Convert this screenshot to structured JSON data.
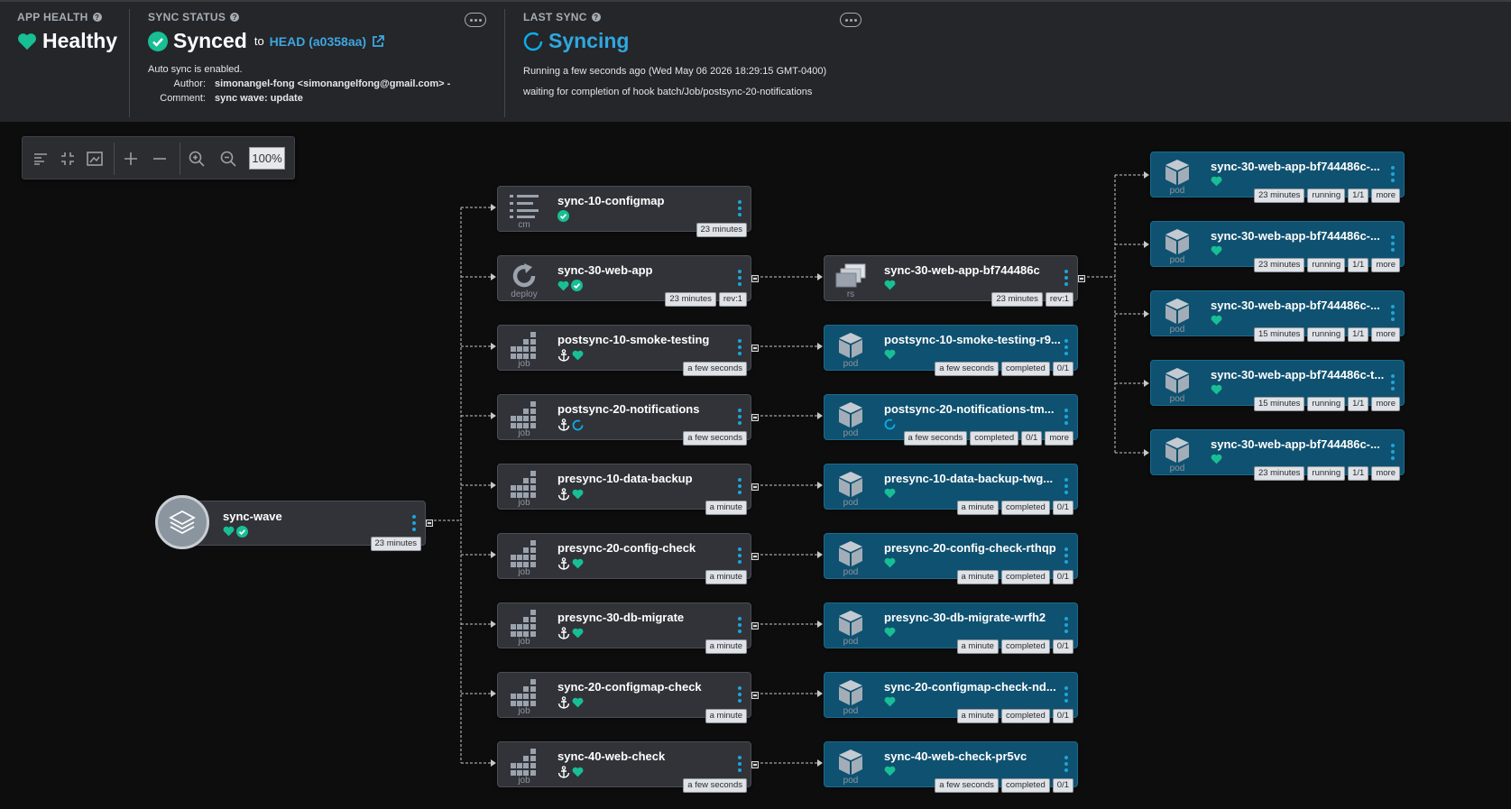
{
  "header": {
    "app_health": {
      "label": "APP HEALTH",
      "value": "Healthy"
    },
    "sync_status": {
      "label": "SYNC STATUS",
      "value": "Synced",
      "to": "to",
      "revision": "HEAD (a0358aa)",
      "auto_sync": "Auto sync is enabled.",
      "author_label": "Author:",
      "author": "simonangel-fong <simonangelfong@gmail.com> -",
      "comment_label": "Comment:",
      "comment": "sync wave: update"
    },
    "last_sync": {
      "label": "LAST SYNC",
      "value": "Syncing",
      "running": "Running a few seconds ago (Wed May 06 2026 18:29:15 GMT-0400)",
      "message": "waiting for completion of hook batch/Job/postsync-20-notifications"
    }
  },
  "toolbar": {
    "zoom": "100%"
  },
  "colors": {
    "healthy": "#18be94",
    "syncing": "#0dadea",
    "link": "#3ea6e0",
    "pod_bg": "#0f5170"
  },
  "app": {
    "name": "sync-wave",
    "age": "23 minutes"
  },
  "resources": [
    {
      "name": "sync-10-configmap",
      "kind": "cm",
      "icon": "list-icon",
      "status": [
        "check"
      ],
      "tags": [
        "23 minutes"
      ]
    },
    {
      "name": "sync-30-web-app",
      "kind": "deploy",
      "icon": "refresh-icon",
      "status": [
        "heart",
        "check"
      ],
      "tags": [
        "23 minutes",
        "rev:1"
      ]
    },
    {
      "name": "postsync-10-smoke-testing",
      "kind": "job",
      "icon": "grid-icon",
      "status": [
        "anchor",
        "heart"
      ],
      "tags": [
        "a few seconds"
      ]
    },
    {
      "name": "postsync-20-notifications",
      "kind": "job",
      "icon": "grid-icon",
      "status": [
        "anchor",
        "spin"
      ],
      "tags": [
        "a few seconds"
      ]
    },
    {
      "name": "presync-10-data-backup",
      "kind": "job",
      "icon": "grid-icon",
      "status": [
        "anchor",
        "heart"
      ],
      "tags": [
        "a minute"
      ]
    },
    {
      "name": "presync-20-config-check",
      "kind": "job",
      "icon": "grid-icon",
      "status": [
        "anchor",
        "heart"
      ],
      "tags": [
        "a minute"
      ]
    },
    {
      "name": "presync-30-db-migrate",
      "kind": "job",
      "icon": "grid-icon",
      "status": [
        "anchor",
        "heart"
      ],
      "tags": [
        "a minute"
      ]
    },
    {
      "name": "sync-20-configmap-check",
      "kind": "job",
      "icon": "grid-icon",
      "status": [
        "anchor",
        "heart"
      ],
      "tags": [
        "a minute"
      ]
    },
    {
      "name": "sync-40-web-check",
      "kind": "job",
      "icon": "grid-icon",
      "status": [
        "anchor",
        "heart"
      ],
      "tags": [
        "a few seconds"
      ]
    }
  ],
  "children": [
    {
      "name": "sync-30-web-app-bf744486c",
      "kind": "rs",
      "icon": "replicaset-icon",
      "pod": false,
      "status": [
        "heart"
      ],
      "tags": [
        "23 minutes",
        "rev:1"
      ]
    },
    {
      "name": "postsync-10-smoke-testing-r9...",
      "kind": "pod",
      "icon": "cube-icon",
      "pod": true,
      "status": [
        "heart"
      ],
      "tags": [
        "a few seconds",
        "completed",
        "0/1"
      ]
    },
    {
      "name": "postsync-20-notifications-tm...",
      "kind": "pod",
      "icon": "cube-icon",
      "pod": true,
      "status": [
        "spin"
      ],
      "tags": [
        "a few seconds",
        "completed",
        "0/1",
        "more"
      ]
    },
    {
      "name": "presync-10-data-backup-twg...",
      "kind": "pod",
      "icon": "cube-icon",
      "pod": true,
      "status": [
        "heart"
      ],
      "tags": [
        "a minute",
        "completed",
        "0/1"
      ]
    },
    {
      "name": "presync-20-config-check-rthqp",
      "kind": "pod",
      "icon": "cube-icon",
      "pod": true,
      "status": [
        "heart"
      ],
      "tags": [
        "a minute",
        "completed",
        "0/1"
      ]
    },
    {
      "name": "presync-30-db-migrate-wrfh2",
      "kind": "pod",
      "icon": "cube-icon",
      "pod": true,
      "status": [
        "heart"
      ],
      "tags": [
        "a minute",
        "completed",
        "0/1"
      ]
    },
    {
      "name": "sync-20-configmap-check-nd...",
      "kind": "pod",
      "icon": "cube-icon",
      "pod": true,
      "status": [
        "heart"
      ],
      "tags": [
        "a minute",
        "completed",
        "0/1"
      ]
    },
    {
      "name": "sync-40-web-check-pr5vc",
      "kind": "pod",
      "icon": "cube-icon",
      "pod": true,
      "status": [
        "heart"
      ],
      "tags": [
        "a few seconds",
        "completed",
        "0/1"
      ]
    }
  ],
  "pods": [
    {
      "name": "sync-30-web-app-bf744486c-...",
      "kind": "pod",
      "status": [
        "heart"
      ],
      "tags": [
        "23 minutes",
        "running",
        "1/1",
        "more"
      ]
    },
    {
      "name": "sync-30-web-app-bf744486c-...",
      "kind": "pod",
      "status": [
        "heart"
      ],
      "tags": [
        "23 minutes",
        "running",
        "1/1",
        "more"
      ]
    },
    {
      "name": "sync-30-web-app-bf744486c-...",
      "kind": "pod",
      "status": [
        "heart"
      ],
      "tags": [
        "15 minutes",
        "running",
        "1/1",
        "more"
      ]
    },
    {
      "name": "sync-30-web-app-bf744486c-t...",
      "kind": "pod",
      "status": [
        "heart"
      ],
      "tags": [
        "15 minutes",
        "running",
        "1/1",
        "more"
      ]
    },
    {
      "name": "sync-30-web-app-bf744486c-...",
      "kind": "pod",
      "status": [
        "heart"
      ],
      "tags": [
        "23 minutes",
        "running",
        "1/1",
        "more"
      ]
    }
  ]
}
